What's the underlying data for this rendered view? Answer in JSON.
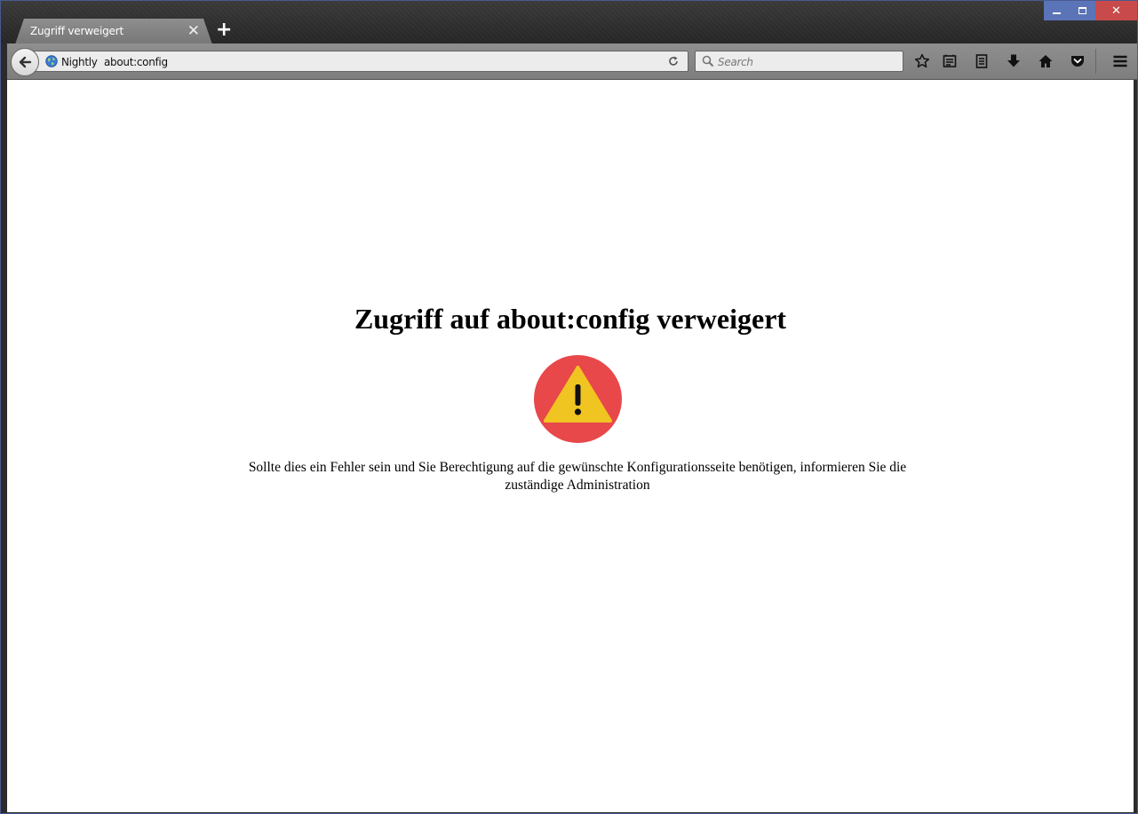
{
  "window": {
    "tab_title": "Zugriff verweigert",
    "new_tab": "+",
    "controls": {
      "minimize": "minimize-icon",
      "maximize": "maximize-icon",
      "close": "close-icon"
    }
  },
  "navbar": {
    "identity_label": "Nightly",
    "url": "about:config",
    "search_placeholder": "Search",
    "icons": [
      "bookmark-star-icon",
      "library-icon",
      "reader-icon",
      "download-icon",
      "home-icon",
      "pocket-icon",
      "menu-icon"
    ]
  },
  "page": {
    "heading": "Zugriff auf about:config verweigert",
    "message": "Sollte dies ein Fehler sein und Sie Berechtigung auf die gewünschte Konfigurationsseite benötigen, informieren Sie die zuständige Administration"
  },
  "colors": {
    "warning_circle": "#e8484a",
    "warning_triangle": "#f0c421",
    "win_button": "#5b74b8",
    "win_close": "#c94a4a"
  }
}
